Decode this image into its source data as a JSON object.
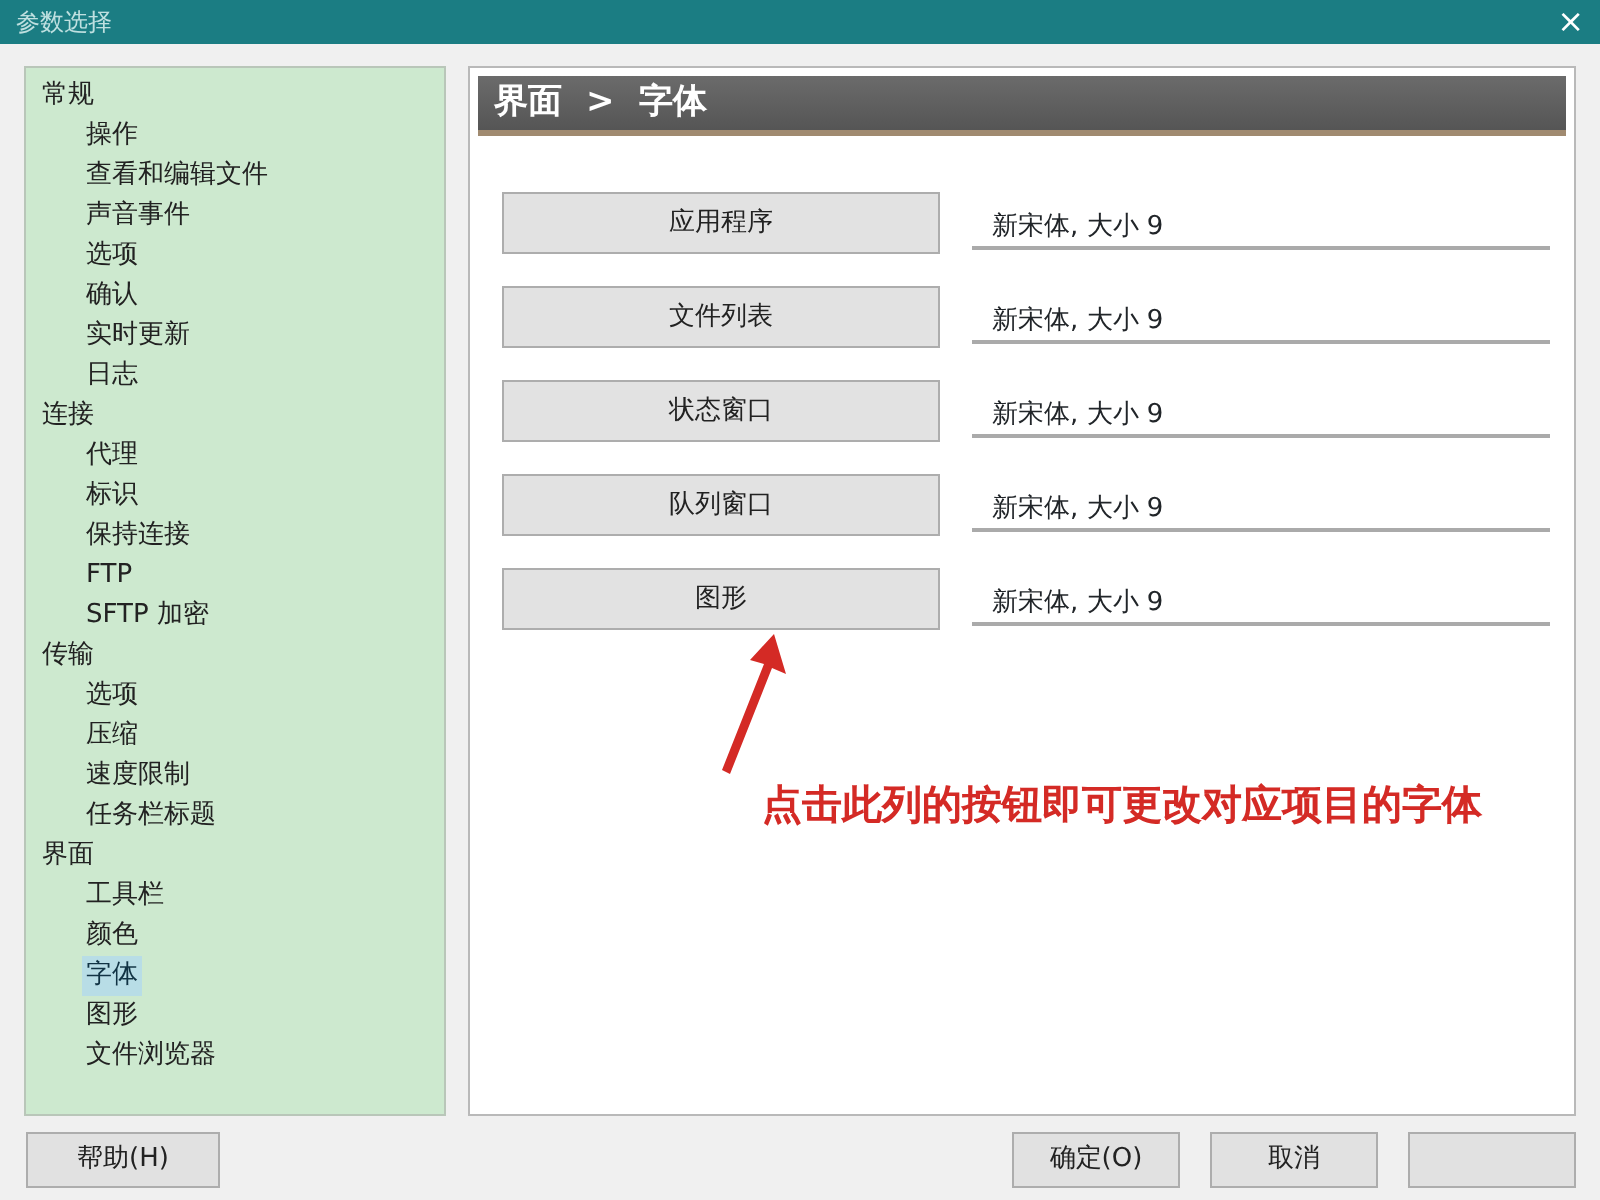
{
  "window": {
    "title": "参数选择",
    "close": "×"
  },
  "tree": [
    {
      "label": "常规",
      "selected": false,
      "children": [
        {
          "label": "操作",
          "selected": false
        },
        {
          "label": "查看和编辑文件",
          "selected": false
        },
        {
          "label": "声音事件",
          "selected": false
        },
        {
          "label": "选项",
          "selected": false
        },
        {
          "label": "确认",
          "selected": false
        },
        {
          "label": "实时更新",
          "selected": false
        },
        {
          "label": "日志",
          "selected": false
        }
      ]
    },
    {
      "label": "连接",
      "selected": false,
      "children": [
        {
          "label": "代理",
          "selected": false
        },
        {
          "label": "标识",
          "selected": false
        },
        {
          "label": "保持连接",
          "selected": false
        },
        {
          "label": "FTP",
          "selected": false
        },
        {
          "label": "SFTP 加密",
          "selected": false
        }
      ]
    },
    {
      "label": "传输",
      "selected": false,
      "children": [
        {
          "label": "选项",
          "selected": false
        },
        {
          "label": "压缩",
          "selected": false
        },
        {
          "label": "速度限制",
          "selected": false
        },
        {
          "label": "任务栏标题",
          "selected": false
        }
      ]
    },
    {
      "label": "界面",
      "selected": false,
      "children": [
        {
          "label": "工具栏",
          "selected": false
        },
        {
          "label": "颜色",
          "selected": false
        },
        {
          "label": "字体",
          "selected": true
        },
        {
          "label": "图形",
          "selected": false
        },
        {
          "label": "文件浏览器",
          "selected": false
        }
      ]
    }
  ],
  "header": {
    "path": [
      "界面",
      "字体"
    ],
    "separator": ">"
  },
  "fonts": [
    {
      "button": "应用程序",
      "value": "新宋体, 大小 9"
    },
    {
      "button": "文件列表",
      "value": "新宋体, 大小 9"
    },
    {
      "button": "状态窗口",
      "value": "新宋体, 大小 9"
    },
    {
      "button": "队列窗口",
      "value": "新宋体, 大小 9"
    },
    {
      "button": "图形",
      "value": "新宋体, 大小 9"
    }
  ],
  "annotation": "点击此列的按钮即可更改对应项目的字体",
  "footer": {
    "help": "帮助(H)",
    "buttons": [
      {
        "kind": "labeled",
        "label": "确定(O)"
      },
      {
        "kind": "labeled",
        "label": "取消"
      },
      {
        "kind": "blank"
      }
    ]
  }
}
